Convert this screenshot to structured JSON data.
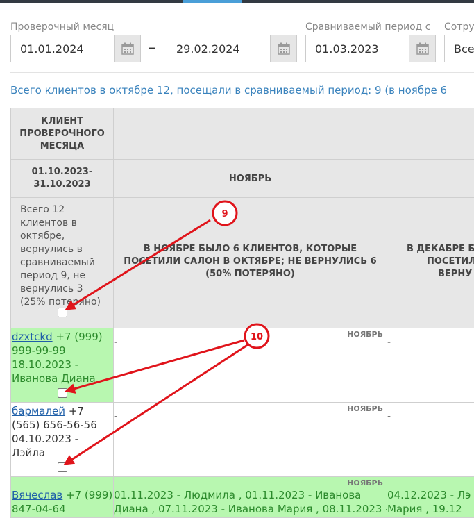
{
  "filters": {
    "check_month_label": "Проверочный месяц",
    "date_from": "01.01.2024",
    "range_dash": "–",
    "date_to": "29.02.2024",
    "compare_label": "Сравниваемый период с",
    "compare_from": "01.03.2023",
    "staff_label": "Сотру",
    "staff_value": "Все"
  },
  "summary": "Всего клиентов в октябре 12, посещали в сравниваемый период: 9 (в ноябре 6",
  "table": {
    "client_header": "Клиент проверочного месяца",
    "period": "01.10.2023-31.10.2023",
    "col_november": "Ноябрь",
    "info_text": "Всего 12 клиентов в октябре, вернулись в сравниваемый период 9, не вернулись 3 (25% потеряно)",
    "november_summary": "В ноябре было 6 клиентов, которые посетили салон в октябре; не вернулись 6 (50% потеряно)",
    "december_summary_line1": "В декабре б",
    "december_summary_line2": "посетил",
    "december_summary_line3": "верну",
    "rows": [
      {
        "name": "dzxtckd",
        "phone": " +7 (999) 999-99-99",
        "details": "18.10.2023 - Иванова Диана",
        "tag": "НОЯБРЬ",
        "nov": "-",
        "dec": "-"
      },
      {
        "name": "бармалей",
        "phone": " +7 (565) 656-56-56",
        "details": "04.10.2023 - Лэйла",
        "tag": "НОЯБРЬ",
        "nov": "-",
        "dec": "-"
      },
      {
        "name": "Вячеслав",
        "phone": " +7 (999)",
        "details": "847-04-64",
        "tag": "НОЯБРЬ",
        "nov": "01.11.2023 - Людмила , 01.11.2023 - Иванова",
        "nov2": "Диана , 07.11.2023 - Иванова Мария , 08.11.2023 -",
        "dec": "04.12.2023 - Лэ",
        "dec2": "Мария , 19.12"
      }
    ]
  },
  "annotations": [
    {
      "label": "9"
    },
    {
      "label": "10"
    }
  ],
  "colors": {
    "accent_blue": "#3a83bd",
    "row_green": "#b8f7b0",
    "annotation_red": "#e0141b",
    "header_gray": "#e7e7e7"
  }
}
